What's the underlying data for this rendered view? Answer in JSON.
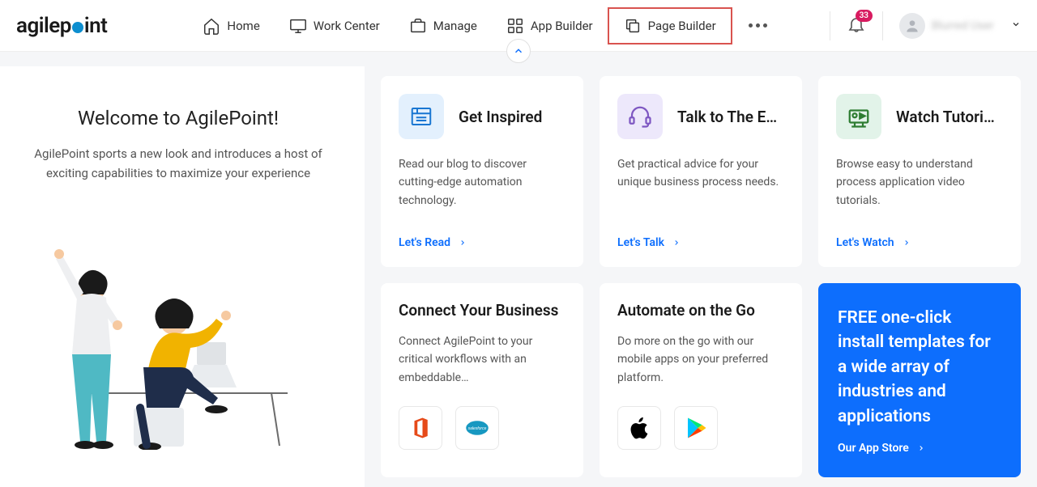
{
  "header": {
    "logo_text": "agilepoint",
    "nav": {
      "home": "Home",
      "work_center": "Work Center",
      "manage": "Manage",
      "app_builder": "App Builder",
      "page_builder": "Page Builder"
    },
    "badge_count": "33",
    "user_name": "Blurred User"
  },
  "sidebar": {
    "title": "Welcome to AgilePoint!",
    "subtitle": "AgilePoint sports a new look and introduces a host of exciting capabilities to maximize your experience"
  },
  "cards": {
    "inspired": {
      "title": "Get Inspired",
      "desc": "Read our blog to discover cutting-edge automation technology.",
      "link": "Let's Read"
    },
    "experts": {
      "title": "Talk to The E…",
      "desc": "Get practical advice for your unique business process needs.",
      "link": "Let's Talk"
    },
    "tutorials": {
      "title": "Watch Tutori…",
      "desc": "Browse easy to understand process application video tutorials.",
      "link": "Let's Watch"
    }
  },
  "cards2": {
    "connect": {
      "title": "Connect Your Business",
      "desc": "Connect AgilePoint to your critical workflows with an embeddable…"
    },
    "automate": {
      "title": "Automate on the Go",
      "desc": "Do more on the go with our mobile apps on your preferred platform."
    }
  },
  "promo": {
    "title": "FREE one-click install templates for a wide array of industries and applications",
    "link": "Our App Store"
  }
}
